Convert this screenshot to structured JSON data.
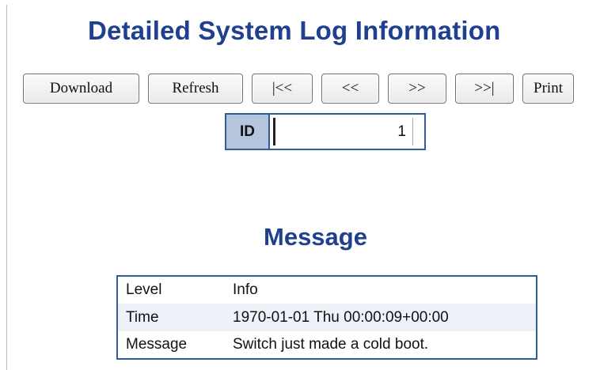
{
  "page": {
    "title": "Detailed System Log Information"
  },
  "toolbar": {
    "download_label": "Download",
    "refresh_label": "Refresh",
    "first_label": "|<<",
    "prev_label": "<<",
    "next_label": ">>",
    "last_label": ">>|",
    "print_label": "Print"
  },
  "id_field": {
    "label": "ID",
    "value": "1"
  },
  "message_section": {
    "title": "Message",
    "rows": [
      {
        "key": "Level",
        "value": "Info"
      },
      {
        "key": "Time",
        "value": "1970-01-01 Thu 00:00:09+00:00"
      },
      {
        "key": "Message",
        "value": "Switch just made a cold boot."
      }
    ]
  },
  "colors": {
    "title": "#1f3f8f",
    "border": "#2e5d9a",
    "id_label_bg": "#b5c5dc",
    "alt_row_bg": "#eef2f8"
  }
}
